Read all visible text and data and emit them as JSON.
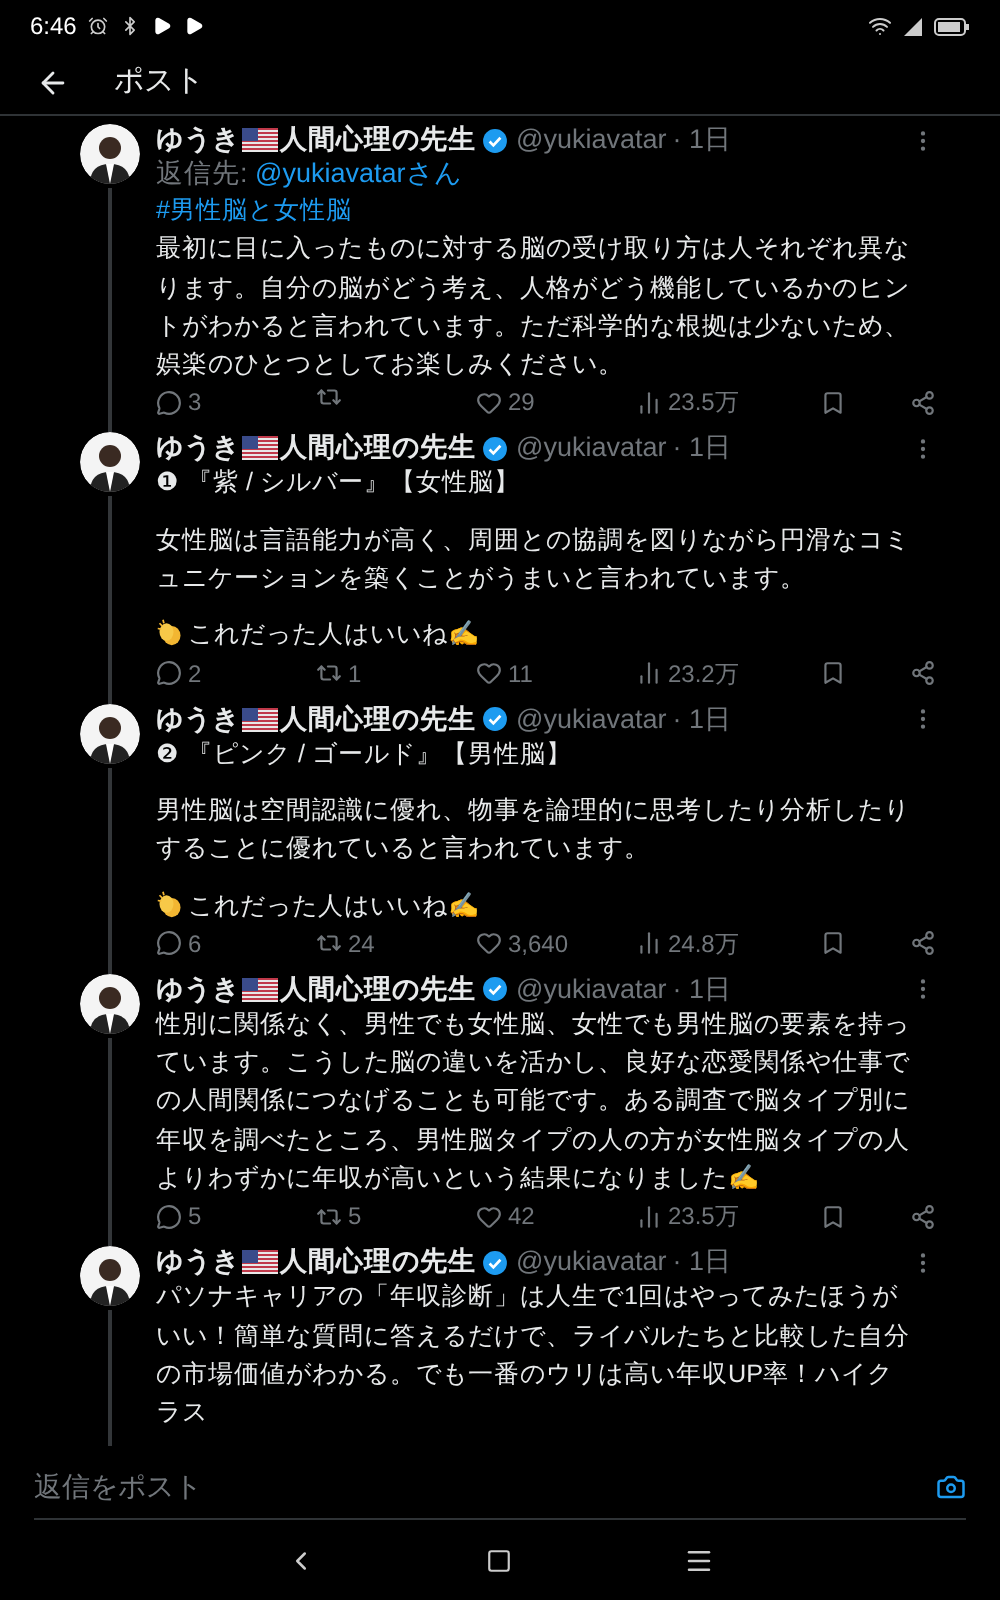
{
  "status_bar": {
    "time": "6:46"
  },
  "header": {
    "title": "ポスト"
  },
  "posts": [
    {
      "name_before": "ゆうき",
      "name_after": "人間心理の先生",
      "verified": true,
      "handle": "@yukiavatar",
      "time": "· 1日",
      "reply_to_label": "返信先:",
      "reply_to": "@yukiavatarさん",
      "paragraphs": [
        [
          {
            "kind": "hashtag",
            "text": "#男性脳と女性脳"
          },
          {
            "kind": "text",
            "text": "最初に目に入ったものに対する脳の受け取り方は人それぞれ異なります。自分の脳がどう考え、人格がどう機能しているかのヒントがわかると言われています。ただ科学的な根拠は少ないため、娯楽のひとつとしてお楽しみください。"
          }
        ]
      ],
      "replies": "3",
      "likes": "29",
      "views": "23.5万"
    },
    {
      "name_before": "ゆうき",
      "name_after": "人間心理の先生",
      "verified": true,
      "handle": "@yukiavatar",
      "time": "· 1日",
      "paragraphs": [
        [
          {
            "kind": "text",
            "text": "❶ 『紫 / シルバー』【女性脳】"
          }
        ],
        [
          {
            "kind": "text",
            "text": "女性脳は言語能力が高く、周囲との協調を図りながら円滑なコミュニケーションを築くことがうまいと言われています。"
          }
        ],
        [
          {
            "kind": "clap"
          },
          {
            "kind": "text",
            "text": "これだった人はいいね✍"
          }
        ]
      ],
      "replies": "2",
      "reposts": "1",
      "likes": "11",
      "views": "23.2万"
    },
    {
      "name_before": "ゆうき",
      "name_after": "人間心理の先生",
      "verified": true,
      "handle": "@yukiavatar",
      "time": "· 1日",
      "paragraphs": [
        [
          {
            "kind": "text",
            "text": "❷ 『ピンク / ゴールド』【男性脳】"
          }
        ],
        [
          {
            "kind": "text",
            "text": "男性脳は空間認識に優れ、物事を論理的に思考したり分析したりすることに優れていると言われています。"
          }
        ],
        [
          {
            "kind": "clap"
          },
          {
            "kind": "text",
            "text": "これだった人はいいね✍"
          }
        ]
      ],
      "replies": "6",
      "reposts": "24",
      "likes": "3,640",
      "views": "24.8万"
    },
    {
      "name_before": "ゆうき",
      "name_after": "人間心理の先生",
      "verified": true,
      "handle": "@yukiavatar",
      "time": "· 1日",
      "paragraphs": [
        [
          {
            "kind": "text",
            "text": "性別に関係なく、男性でも女性脳、女性でも男性脳の要素を持っています。こうした脳の違いを活かし、良好な恋愛関係や仕事での人間関係につなげることも可能です。ある調査で脳タイプ別に年収を調べたところ、男性脳タイプの人の方が女性脳タイプの人よりわずかに年収が高いという結果になりました✍"
          }
        ]
      ],
      "replies": "5",
      "reposts": "5",
      "likes": "42",
      "views": "23.5万"
    },
    {
      "name_before": "ゆうき",
      "name_after": "人間心理の先生",
      "verified": true,
      "handle": "@yukiavatar",
      "time": "· 1日",
      "paragraphs": [
        [
          {
            "kind": "text",
            "text": "パソナキャリアの「年収診断」は人生で1回はやってみたほうがいい！簡単な質問に答えるだけで、ライバルたちと比較した自分の市場価値がわかる。でも一番のウリは高い年収UP率！ハイクラス"
          }
        ]
      ]
    }
  ],
  "reply_bar": {
    "placeholder": "返信をポスト"
  }
}
